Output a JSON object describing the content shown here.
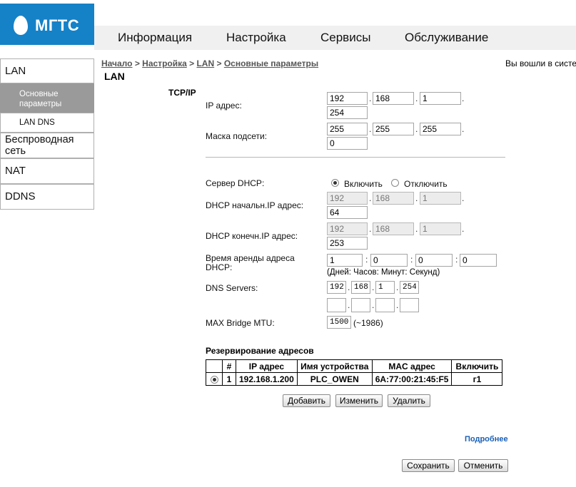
{
  "logo": {
    "text": "МГТС"
  },
  "top_menu": [
    "Информация",
    "Настройка",
    "Сервисы",
    "Обслуживание"
  ],
  "sidebar": {
    "items": [
      {
        "label": "LAN"
      },
      {
        "label": "Основные параметры"
      },
      {
        "label": "LAN DNS"
      },
      {
        "label": "Беспроводная сеть"
      },
      {
        "label": "NAT"
      },
      {
        "label": "DDNS"
      }
    ]
  },
  "breadcrumb": [
    "Начало",
    "Настройка",
    "LAN",
    "Основные параметры"
  ],
  "login_status": "Вы вошли в систе",
  "page_title": "LAN",
  "section_tcpip": "TCP/IP",
  "ip": {
    "label": "IP адрес:",
    "octets": [
      "192",
      "168",
      "1",
      "254"
    ]
  },
  "mask": {
    "label": "Маска подсети:",
    "octets": [
      "255",
      "255",
      "255",
      "0"
    ]
  },
  "dhcp_server": {
    "label": "Сервер DHCP:",
    "on_label": "Включить",
    "off_label": "Отключить",
    "value": "on"
  },
  "dhcp_start": {
    "label": "DHCP начальн.IP адрес:",
    "octets": [
      "192",
      "168",
      "1",
      "64"
    ]
  },
  "dhcp_end": {
    "label": "DHCP конечн.IP адрес:",
    "octets": [
      "192",
      "168",
      "1",
      "253"
    ]
  },
  "lease": {
    "label": "Время аренды адреса DHCP:",
    "values": [
      "1",
      "0",
      "0",
      "0"
    ],
    "hint": "(Дней: Часов: Минут: Секунд)"
  },
  "dns": {
    "label": "DNS Servers:",
    "primary": [
      "192",
      "168",
      "1",
      "254"
    ],
    "secondary": [
      "",
      "",
      "",
      ""
    ]
  },
  "mtu": {
    "label": "MAX Bridge MTU:",
    "value": "1500",
    "hint": "(~1986)"
  },
  "reservation": {
    "title": "Резервирование адресов",
    "headers": [
      "",
      "#",
      "IP адрес",
      "Имя устройства",
      "MAC адрес",
      "Включить"
    ],
    "rows": [
      {
        "num": "1",
        "ip": "192.168.1.200",
        "name": "PLC_OWEN",
        "mac": "6A:77:00:21:45:F5",
        "enable": "г1"
      }
    ],
    "buttons": {
      "add": "Добавить",
      "edit": "Изменить",
      "delete": "Удалить"
    }
  },
  "more_link": "Подробнее",
  "actions": {
    "save": "Сохранить",
    "cancel": "Отменить"
  },
  "colors": {
    "brand": "#1582c8",
    "sidebar_active": "#9a9a9a",
    "link": "#1a5fb4"
  }
}
